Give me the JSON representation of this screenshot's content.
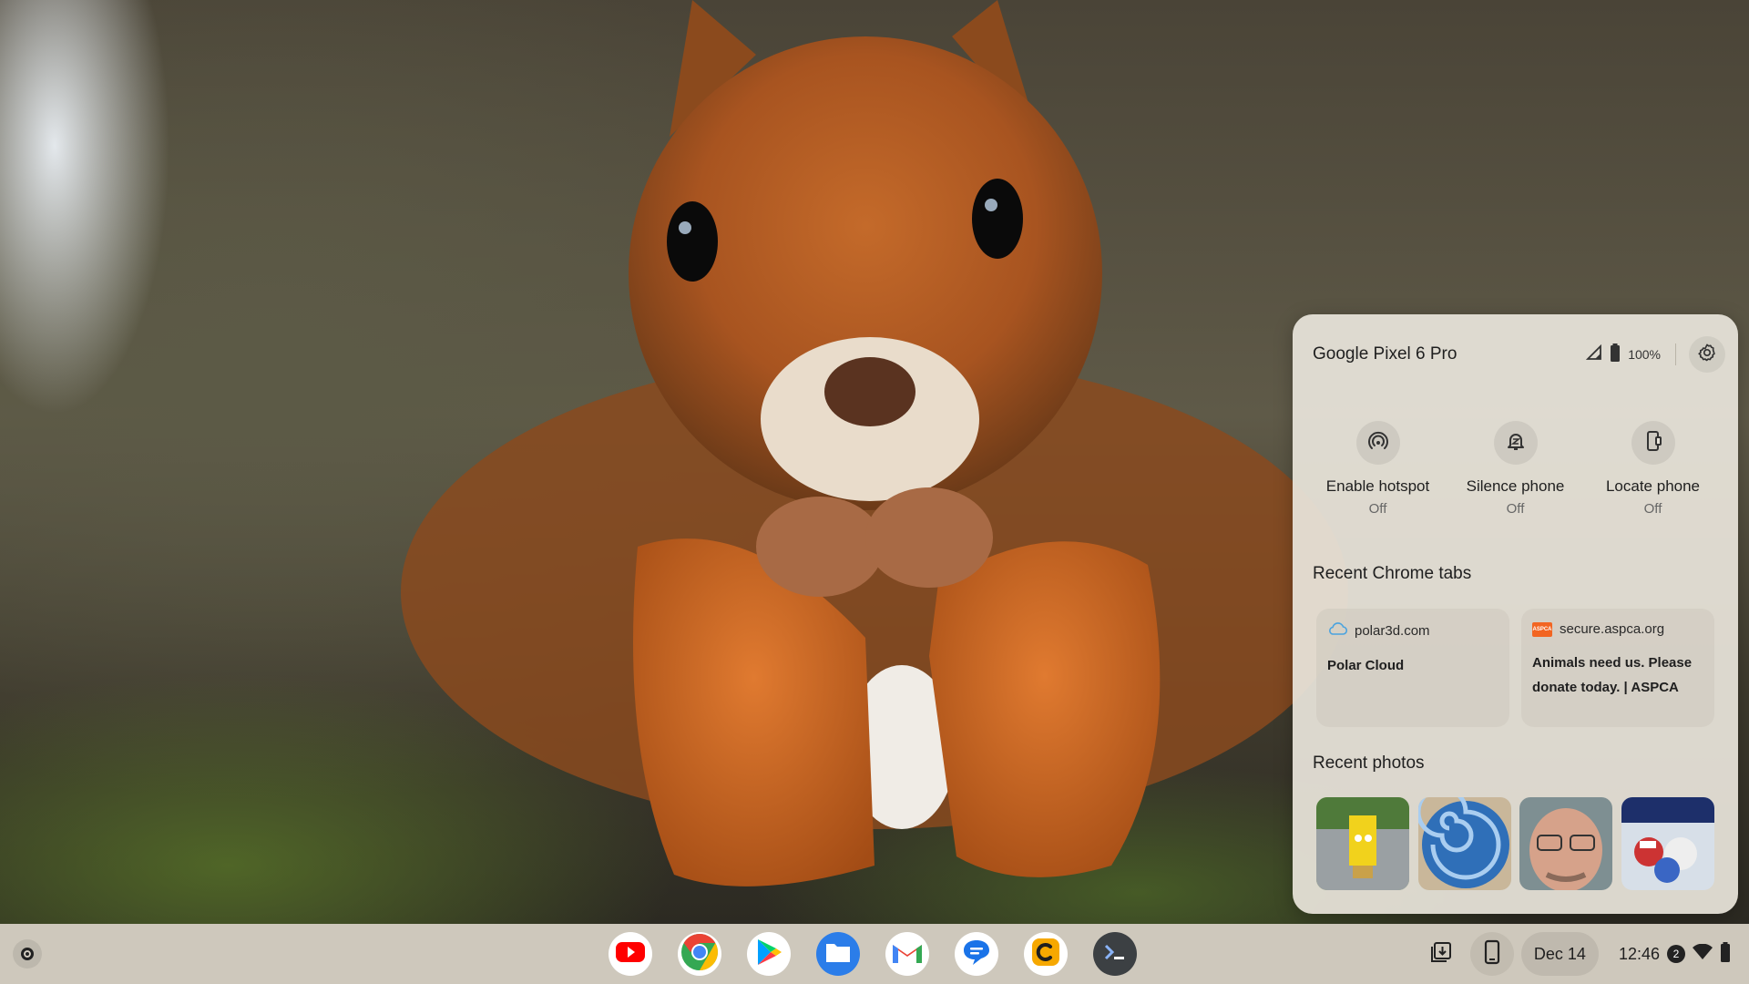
{
  "phone_hub": {
    "device_name": "Google Pixel 6 Pro",
    "battery": "100%",
    "toggles": [
      {
        "label": "Enable hotspot",
        "state": "Off",
        "icon": "hotspot-icon"
      },
      {
        "label": "Silence phone",
        "state": "Off",
        "icon": "silence-bell-icon"
      },
      {
        "label": "Locate phone",
        "state": "Off",
        "icon": "locate-phone-icon"
      }
    ],
    "recent_tabs_title": "Recent Chrome tabs",
    "tabs": [
      {
        "site": "polar3d.com",
        "title": "Polar Cloud",
        "icon": "cloud-icon"
      },
      {
        "site": "secure.aspca.org",
        "title": "Animals need us. Please donate today. | ASPCA",
        "icon": "aspca-icon"
      }
    ],
    "recent_photos_title": "Recent photos",
    "photos": [
      "sponge-figure-photo",
      "blue-swirl-photo",
      "selfie-photo",
      "stuffed-toys-photo"
    ]
  },
  "shelf": {
    "apps": [
      "youtube-icon",
      "chrome-icon",
      "play-store-icon",
      "files-icon",
      "gmail-icon",
      "messages-icon",
      "c-app-icon",
      "terminal-icon"
    ],
    "date": "Dec 14",
    "time": "12:46",
    "notification_count": "2"
  },
  "colors": {
    "panel_bg": "#e8e4da",
    "shelf_bg": "#d6d0c4",
    "aspca_orange": "#f26522"
  }
}
